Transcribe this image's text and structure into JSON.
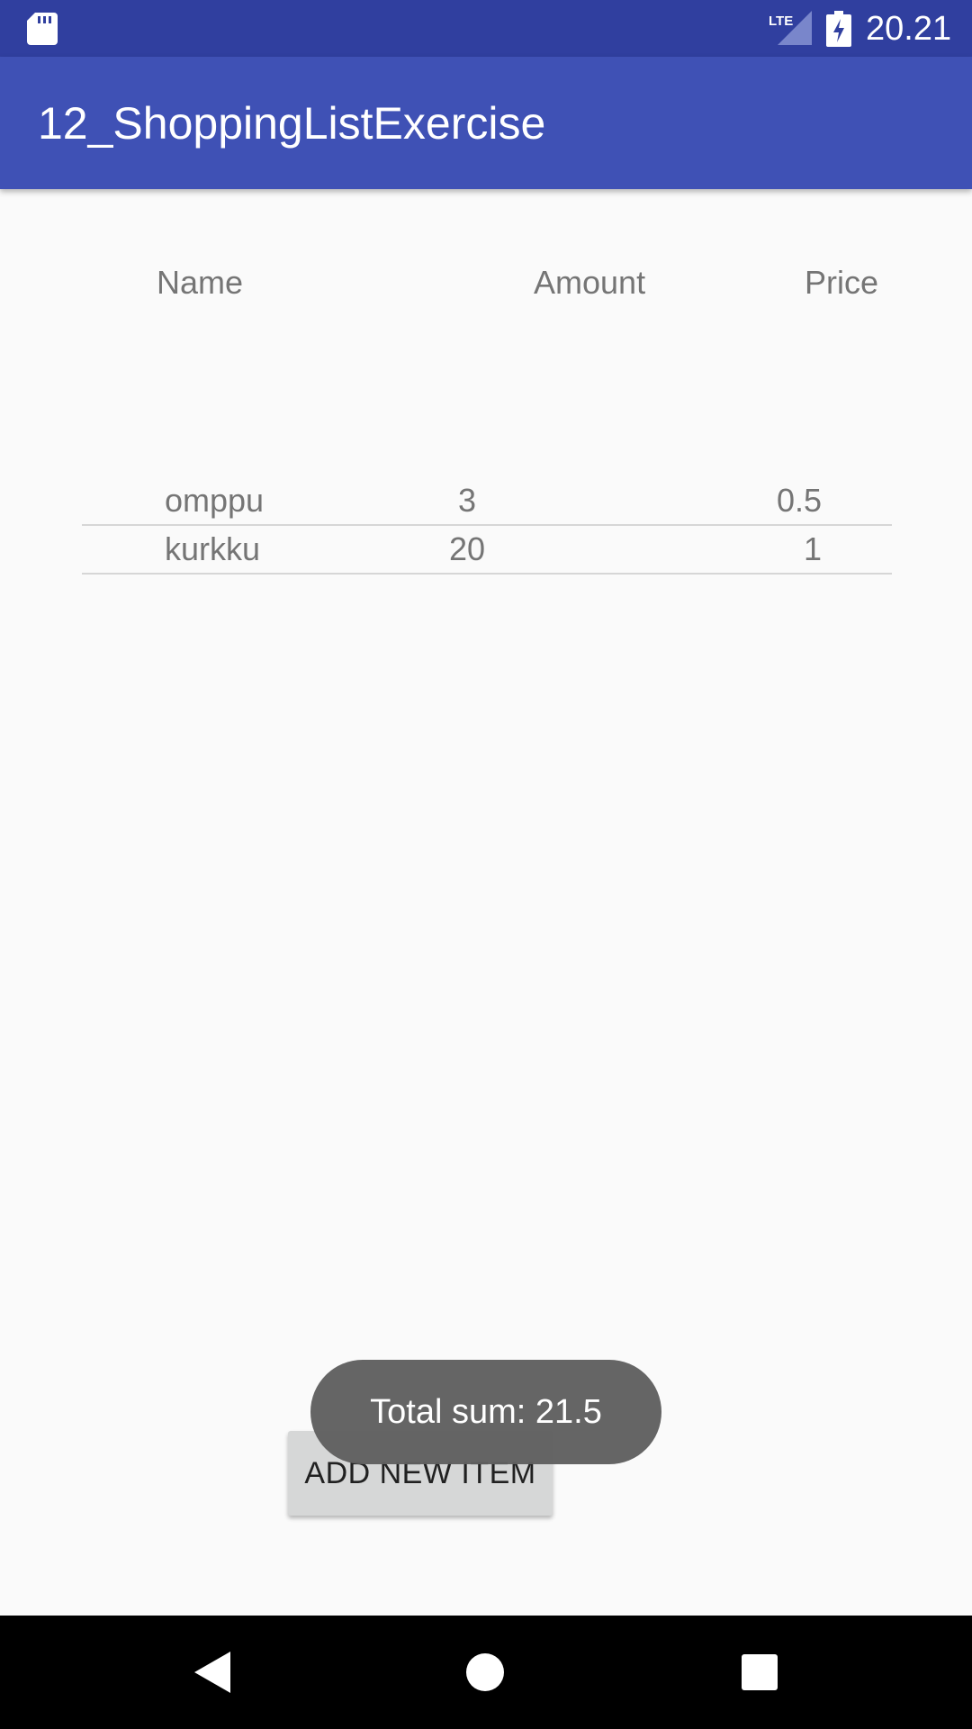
{
  "status_bar": {
    "time": "20.21",
    "network_label": "LTE",
    "icons": [
      "sd-card-icon",
      "lte-signal-icon",
      "battery-charging-icon"
    ]
  },
  "app_bar": {
    "title": "12_ShoppingListExercise"
  },
  "table": {
    "headers": {
      "name": "Name",
      "amount": "Amount",
      "price": "Price"
    },
    "rows": [
      {
        "name": "omppu",
        "amount": "3",
        "price": "0.5"
      },
      {
        "name": "kurkku",
        "amount": "20",
        "price": "1"
      }
    ]
  },
  "actions": {
    "add_label": "ADD NEW ITEM"
  },
  "toast": {
    "message": "Total sum: 21.5"
  },
  "nav_bar": {
    "icons": [
      "back-icon",
      "home-icon",
      "recents-icon"
    ]
  },
  "colors": {
    "status_bar": "#303f9f",
    "app_bar": "#3f51b5",
    "background": "#fafafa",
    "button": "#d6d7d7",
    "toast": "#606060"
  }
}
